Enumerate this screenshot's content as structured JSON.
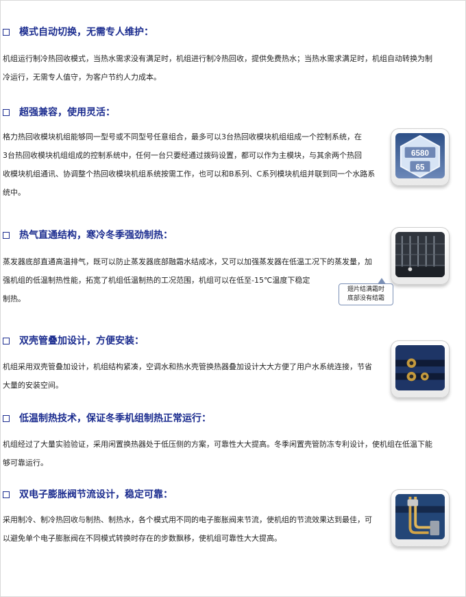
{
  "sections": [
    {
      "title": "模式自动切换，无需专人维护：",
      "lines": [
        "机组运行制冷热回收模式，当热水需求没有满足时，机组进行制冷热回收，提供免费热水；当热水需求满足时，机组自动转换为制",
        "冷运行，无需专人值守，为客户节约人力成本。"
      ]
    },
    {
      "title": "超强兼容，使用灵活：",
      "lines": [
        "格力热回收模块机组能够同一型号或不同型号任意组合，最多可以3台热回收模块机组组成一个控制系统，在",
        "3台热回收模块机组组成的控制系统中，任何一台只要经通过拨码设置，都可以作为主模块，与其余两个热回",
        "收模块机组通讯、协调整个热回收模块机组系统按需工作，也可以和B系列、C系列模块机组并联到同一个水路系",
        "统中。"
      ],
      "badge": {
        "line1": "6580",
        "line2": "65"
      }
    },
    {
      "title": "热气直通结构，寒冷冬季强劲制热：",
      "lines": [
        "蒸发器底部直通高温排气，既可以防止蒸发器底部融霜水结成冰，又可以加强蒸发器在低温工况下的蒸发量，加",
        "强机组的低温制热性能，拓宽了机组低温制热的工况范围，机组可以在低至-15℃温度下稳定",
        "制热。"
      ],
      "callout": {
        "line1": "翅片结满霜时",
        "line2": "底部没有结霜"
      }
    },
    {
      "title": "双壳管叠加设计，方便安装：",
      "lines": [
        "机组采用双壳管叠加设计，机组结构紧凑，空调水和热水壳管换热器叠加设计大大方便了用户水系统连接，节省",
        "大量的安装空间。"
      ]
    },
    {
      "title": "低温制热技术，保证冬季机组制热正常运行：",
      "lines": [
        "机组经过了大量实验验证，采用闲置换热器处于低压侧的方案，可靠性大大提高。冬季闲置壳管防冻专利设计，使机组在低温下能",
        "够可靠运行。"
      ]
    },
    {
      "title": "双电子膨胀阀节流设计，稳定可靠：",
      "lines": [
        "采用制冷、制冷热回收与制热、制热水，各个模式用不同的电子膨胀阀来节流，使机组的节流效果达到最佳，可",
        "以避免单个电子膨胀阀在不同模式转换时存在的步数飘移，使机组可靠性大大提高。"
      ]
    }
  ],
  "colors": {
    "heading": "#1b2c8f",
    "body_text": "#222222"
  }
}
